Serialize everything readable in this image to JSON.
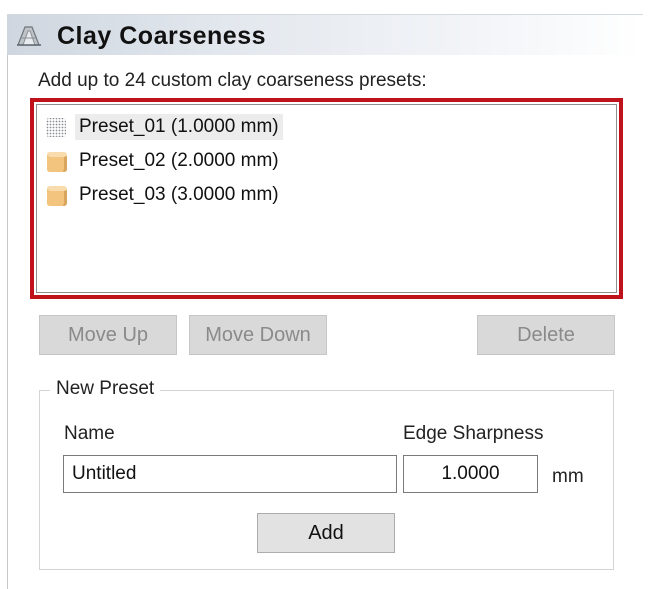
{
  "header": {
    "title": "Clay Coarseness",
    "icon": "clay-tool-icon"
  },
  "description": "Add up to 24 custom clay coarseness presets:",
  "presets": [
    {
      "label": "Preset_01 (1.0000 mm)",
      "icon": "dotted-cube-icon",
      "selected": true
    },
    {
      "label": "Preset_02 (2.0000 mm)",
      "icon": "clay-cube-icon",
      "selected": false
    },
    {
      "label": "Preset_03 (3.0000 mm)",
      "icon": "clay-cube-icon",
      "selected": false
    }
  ],
  "buttons": {
    "move_up": "Move Up",
    "move_down": "Move Down",
    "delete": "Delete",
    "add": "Add"
  },
  "new_preset": {
    "legend": "New Preset",
    "name_label": "Name",
    "name_value": "Untitled",
    "sharpness_label": "Edge Sharpness",
    "sharpness_value": "1.0000",
    "unit": "mm"
  },
  "colors": {
    "highlight_border": "#c0121b",
    "clay": "#f0c27a"
  }
}
